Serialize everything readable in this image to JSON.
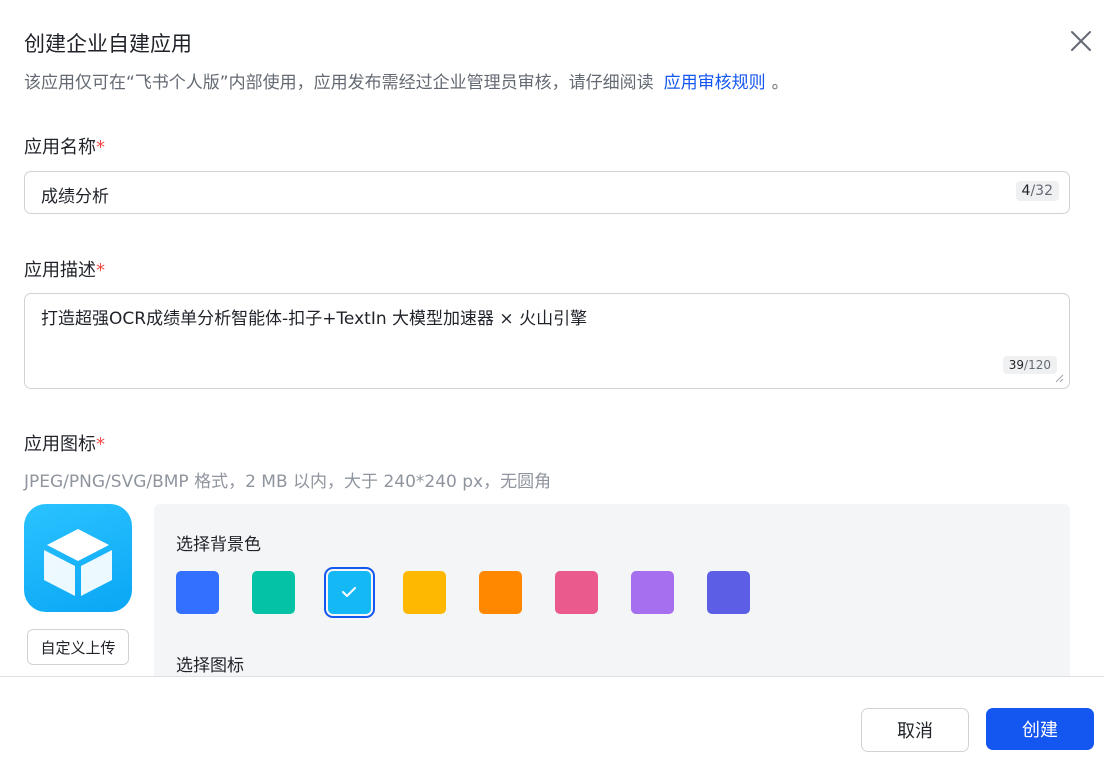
{
  "dialog": {
    "title": "创建企业自建应用",
    "subtitle_text": "该应用仅可在“飞书个人版”内部使用，应用发布需经过企业管理员审核，请仔细阅读",
    "subtitle_link": "应用审核规则",
    "subtitle_tail": "。"
  },
  "name_field": {
    "label": "应用名称",
    "required_mark": "*",
    "value": "成绩分析",
    "count": "4",
    "max": "/32"
  },
  "desc_field": {
    "label": "应用描述",
    "required_mark": "*",
    "value": "打造超强OCR成绩单分析智能体-扣子+TextIn 大模型加速器 × 火山引擎",
    "count": "39",
    "max": "/120"
  },
  "icon_field": {
    "label": "应用图标",
    "required_mark": "*",
    "hint": "JPEG/PNG/SVG/BMP 格式，2 MB 以内，大于 240*240 px，无圆角",
    "upload_label": "自定义上传",
    "bg_label": "选择背景色",
    "icon_label": "选择图标",
    "colors": [
      "#3370ff",
      "#04c2a5",
      "#14b8f5",
      "#ffb800",
      "#ff8800",
      "#ea5a8c",
      "#a66ff0",
      "#5c5fe6"
    ],
    "selected_color_index": 2
  },
  "footer": {
    "cancel_label": "取消",
    "create_label": "创建"
  }
}
